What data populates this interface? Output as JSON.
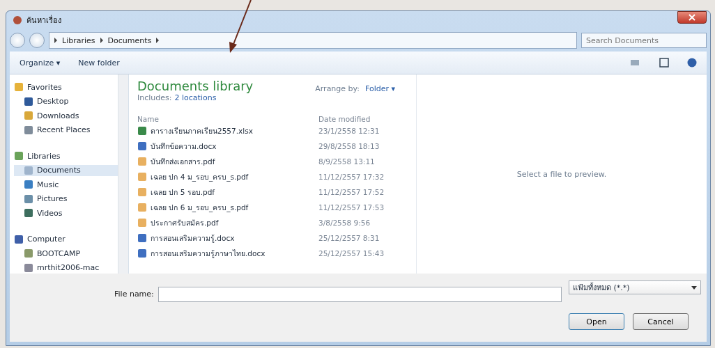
{
  "window": {
    "title": "ค้นหาเรื่อง"
  },
  "address": {
    "crumbs": [
      "Libraries",
      "Documents"
    ],
    "search_placeholder": "Search Documents"
  },
  "toolbar": {
    "organize": "Organize ▾",
    "new_folder": "New folder"
  },
  "sidebar": {
    "groups": [
      {
        "label": "Favorites",
        "children": [
          {
            "label": "Desktop",
            "selected": false
          },
          {
            "label": "Downloads",
            "selected": false
          },
          {
            "label": "Recent Places",
            "selected": false
          }
        ]
      },
      {
        "label": "Libraries",
        "children": [
          {
            "label": "Documents",
            "selected": true
          },
          {
            "label": "Music",
            "selected": false
          },
          {
            "label": "Pictures",
            "selected": false
          },
          {
            "label": "Videos",
            "selected": false
          }
        ]
      },
      {
        "label": "Computer",
        "children": [
          {
            "label": "BOOTCAMP",
            "selected": false
          },
          {
            "label": "mrthit2006-mac",
            "selected": false
          }
        ]
      }
    ]
  },
  "library": {
    "title": "Documents library",
    "includes": "Includes:",
    "locations": "2 locations",
    "arrange_label": "Arrange by:",
    "arrange_value": "Folder ▾"
  },
  "table": {
    "columns": [
      "Name",
      "Date modified"
    ],
    "rows": [
      {
        "kind": "excel",
        "name": "ตารางเรียนภาคเรียน2557.xlsx",
        "date": "23/1/2558 12:31"
      },
      {
        "kind": "word",
        "name": "บันทึกข้อความ.docx",
        "date": "29/8/2558 18:13"
      },
      {
        "kind": "pdf",
        "name": "บันทึกส่งเอกสาร.pdf",
        "date": "8/9/2558 13:11"
      },
      {
        "kind": "pdf",
        "name": "เฉลย ปก 4 ม_รอบ_ครบ_s.pdf",
        "date": "11/12/2557 17:32"
      },
      {
        "kind": "pdf",
        "name": "เฉลย ปก 5 รอบ.pdf",
        "date": "11/12/2557 17:52"
      },
      {
        "kind": "pdf",
        "name": "เฉลย ปก 6 ม_รอบ_ครบ_s.pdf",
        "date": "11/12/2557 17:53"
      },
      {
        "kind": "pdf",
        "name": "ประกาศรับสมัคร.pdf",
        "date": "3/8/2558 9:56"
      },
      {
        "kind": "word",
        "name": "การสอนเสริมความรู้.docx",
        "date": "25/12/2557 8:31"
      },
      {
        "kind": "word",
        "name": "การสอนเสริมความรู้ภาษาไทย.docx",
        "date": "25/12/2557 15:43"
      }
    ]
  },
  "preview": {
    "message": "Select a file to preview."
  },
  "footer": {
    "file_name_label": "File name:",
    "file_type": "แฟ้มทั้งหมด (*.*)",
    "open": "Open",
    "cancel": "Cancel"
  }
}
